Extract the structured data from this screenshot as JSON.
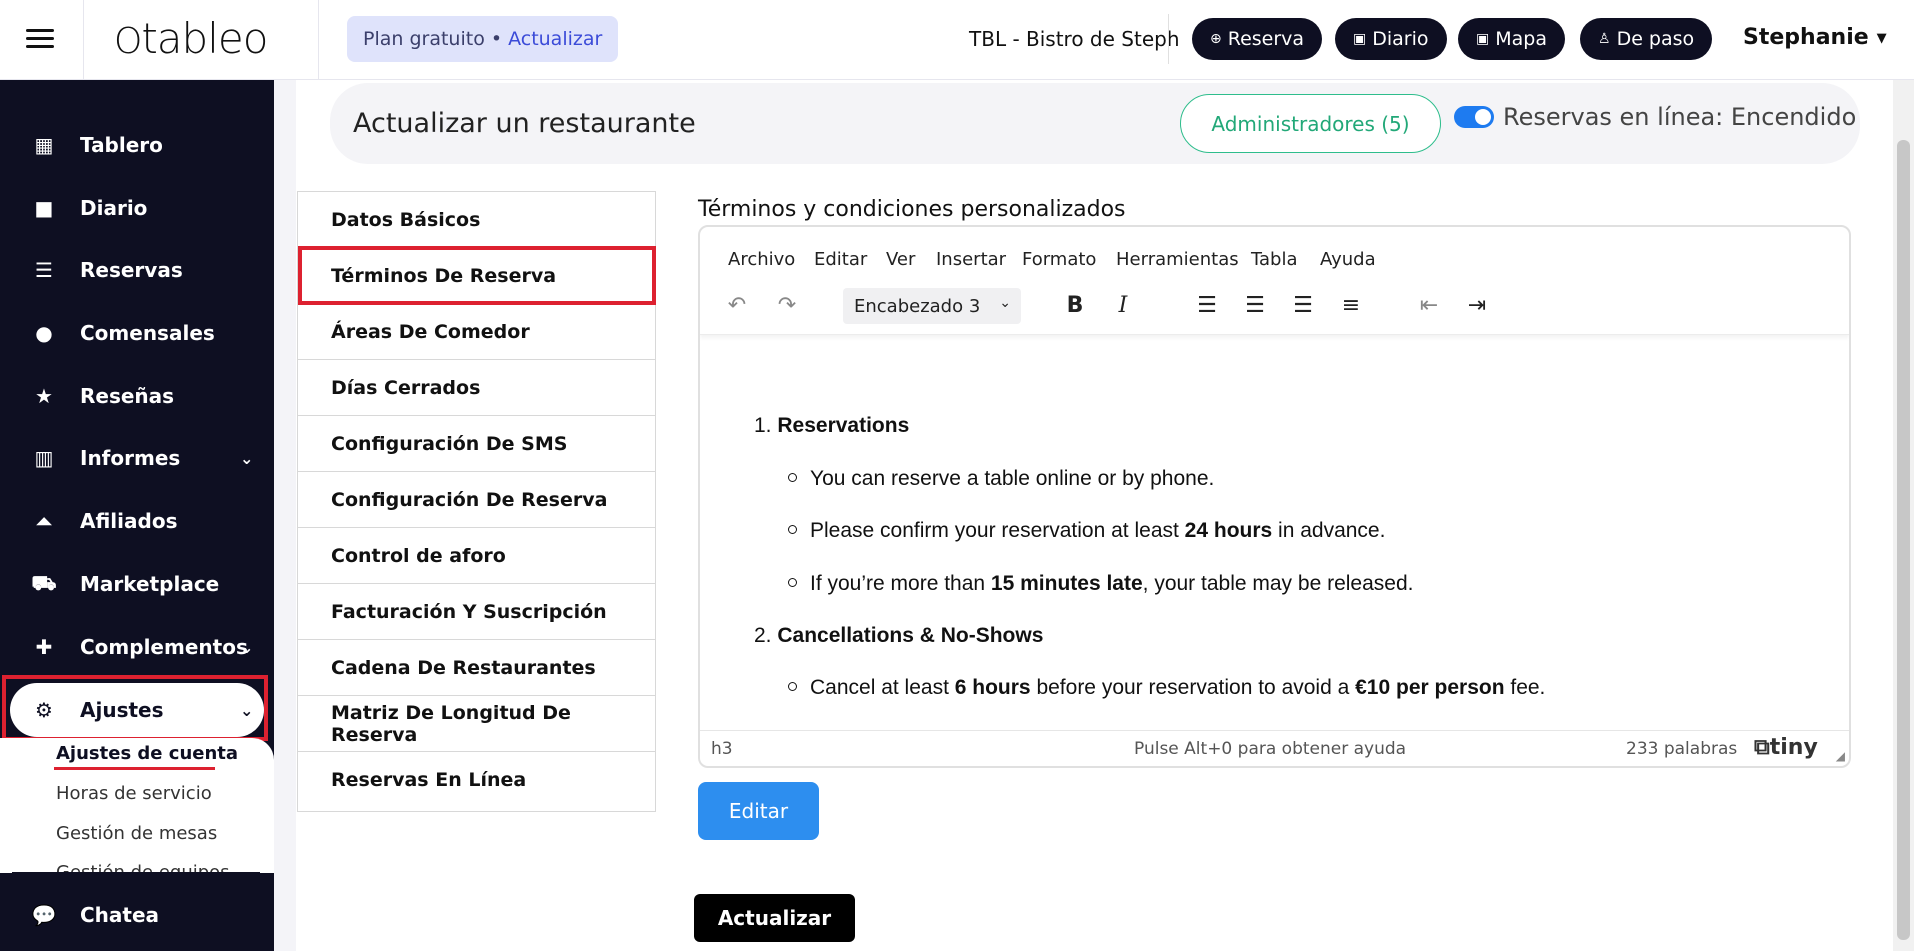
{
  "topbar": {
    "logo": "tableo",
    "plan_label": "Plan gratuito •",
    "plan_upgrade": "Actualizar",
    "restaurant_name": "TBL - Bistro de Steph",
    "buttons": [
      {
        "label": "Reserva",
        "icon": "plus-circle-icon"
      },
      {
        "label": "Diario",
        "icon": "calendar-icon"
      },
      {
        "label": "Mapa",
        "icon": "calendar-icon"
      },
      {
        "label": "De paso",
        "icon": "walking-icon"
      }
    ],
    "user_name": "Stephanie"
  },
  "sidebar": {
    "items": [
      {
        "label": "Tablero",
        "icon": "dashboard-icon"
      },
      {
        "label": "Diario",
        "icon": "book-icon"
      },
      {
        "label": "Reservas",
        "icon": "list-icon"
      },
      {
        "label": "Comensales",
        "icon": "user-icon"
      },
      {
        "label": "Reseñas",
        "icon": "star-icon"
      },
      {
        "label": "Informes",
        "icon": "chart-icon"
      },
      {
        "label": "Afiliados",
        "icon": "bell-icon"
      },
      {
        "label": "Marketplace",
        "icon": "cart-icon"
      },
      {
        "label": "Complementos",
        "icon": "puzzle-icon"
      },
      {
        "label": "Ajustes",
        "icon": "gear-icon"
      }
    ],
    "submenu": [
      "Ajustes de cuenta",
      "Horas de servicio",
      "Gestión de mesas",
      "Gestión de equipos"
    ],
    "chat_label": "Chatea"
  },
  "header": {
    "title": "Actualizar un restaurante",
    "admins_button": "Administradores (5)",
    "online_label": "Reservas en línea: Encendido",
    "online_enabled": true
  },
  "settings_menu": [
    "Datos Básicos",
    "Términos De Reserva",
    "Áreas De Comedor",
    "Días Cerrados",
    "Configuración De SMS",
    "Configuración De Reserva",
    "Control de aforo",
    "Facturación Y Suscripción",
    "Cadena De Restaurantes",
    "Matriz De Longitud De Reserva",
    "Reservas En Línea"
  ],
  "editor": {
    "section_title": "Términos y condiciones personalizados",
    "menu": [
      "Archivo",
      "Editar",
      "Ver",
      "Insertar",
      "Formato",
      "Herramientas",
      "Tabla",
      "Ayuda"
    ],
    "block_format": "Encabezado 3",
    "content": {
      "h1_num": "1.",
      "h1": "Reservations",
      "b1": "You can reserve a table online or by phone.",
      "b2_pre": "Please confirm your reservation at least ",
      "b2_bold": "24 hours",
      "b2_post": " in advance.",
      "b3_pre": "If you’re more than ",
      "b3_bold": "15 minutes late",
      "b3_post": ", your table may be released.",
      "h2_num": "2.",
      "h2": "Cancellations & No-Shows",
      "b4_pre": "Cancel at least ",
      "b4_bold1": "6 hours",
      "b4_mid": " before your reservation to avoid a ",
      "b4_bold2": "€10 per person",
      "b4_post": " fee."
    },
    "status_path": "h3",
    "status_help": "Pulse Alt+0 para obtener ayuda",
    "status_words": "233 palabras",
    "brand": "tiny"
  },
  "actions": {
    "edit_label": "Editar",
    "update_label": "Actualizar"
  }
}
